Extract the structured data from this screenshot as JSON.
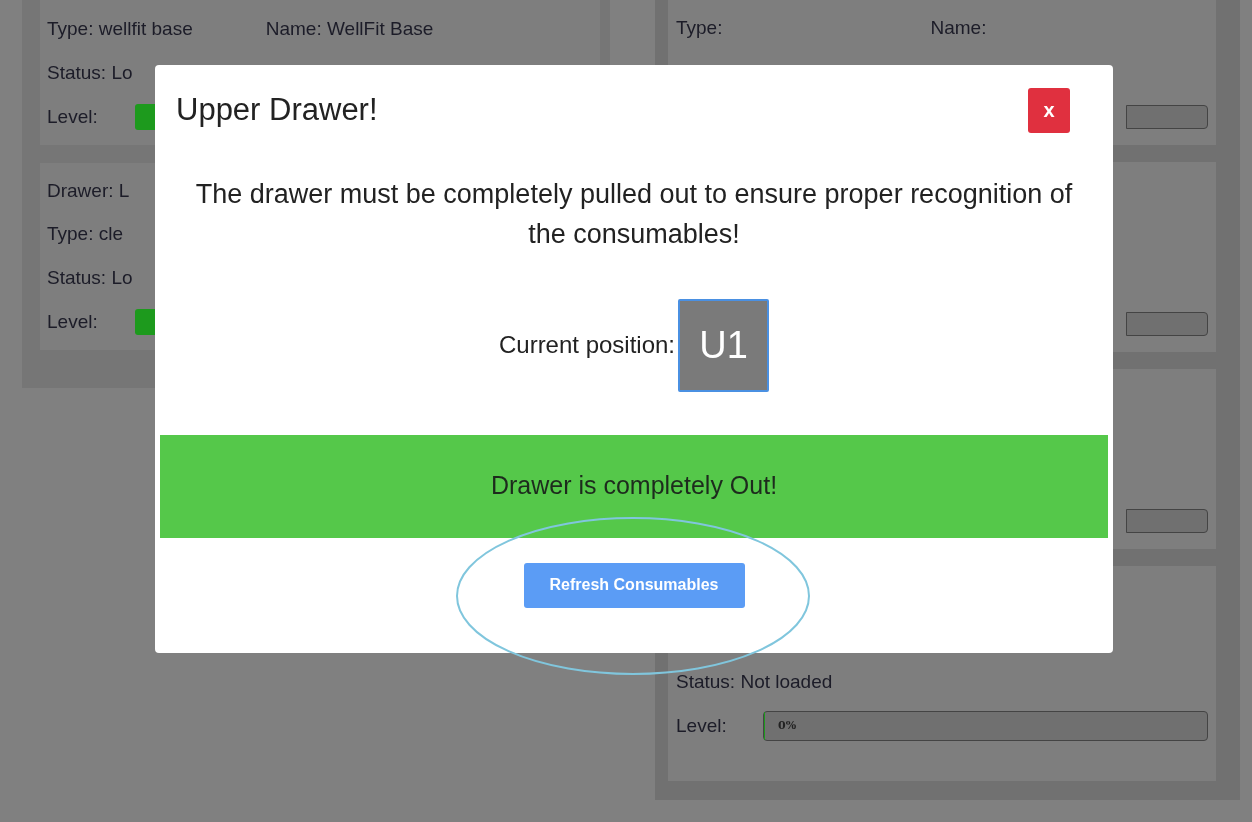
{
  "background": {
    "left_cards": [
      {
        "rows": [
          {
            "kind": "text",
            "cells": [
              "Type: wellfit base",
              "Name: WellFit Base"
            ]
          },
          {
            "kind": "text",
            "cells": [
              "Status: Lo"
            ]
          },
          {
            "kind": "level-stub",
            "label": "Level:"
          }
        ]
      },
      {
        "rows": [
          {
            "kind": "text",
            "cells": [
              "Drawer: L"
            ]
          },
          {
            "kind": "text",
            "cells": [
              "Type: cle"
            ]
          },
          {
            "kind": "text",
            "cells": [
              "Status: Lo"
            ]
          },
          {
            "kind": "level-stub",
            "label": "Level:"
          }
        ]
      }
    ],
    "right_cards": [
      {
        "rows": [
          {
            "kind": "text",
            "cells": [
              "Type:",
              "Name:"
            ]
          },
          {
            "kind": "level-tail"
          }
        ]
      },
      {
        "rows": [
          {
            "kind": "level-tail"
          }
        ]
      },
      {
        "rows": [
          {
            "kind": "level-tail"
          }
        ]
      },
      {
        "rows": [
          {
            "kind": "text",
            "cells": [
              "Status: Not loaded"
            ]
          },
          {
            "kind": "level",
            "label": "Level:",
            "level": 0,
            "reading": "0%"
          }
        ]
      }
    ]
  },
  "dialog": {
    "title": "Upper Drawer!",
    "close": "x",
    "message": "The drawer must be completely pulled out to ensure proper recognition of the consumables!",
    "position_label": "Current position:",
    "position": "U1",
    "status": "Drawer is completely Out!",
    "button": "Refresh Consumables"
  }
}
